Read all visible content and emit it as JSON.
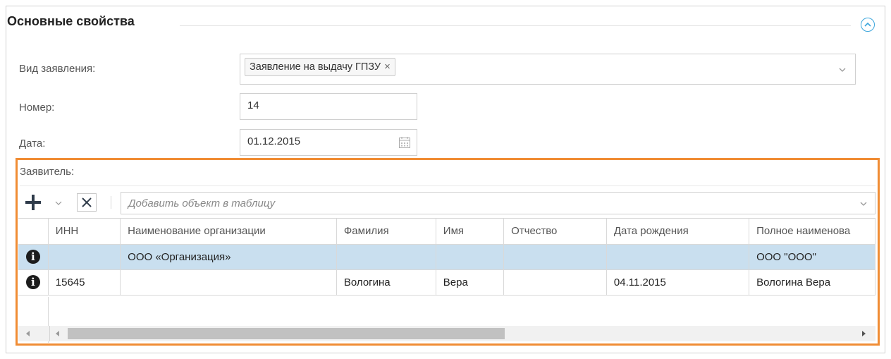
{
  "section": {
    "title": "Основные свойства",
    "collapse_icon": "chevron-up-circle-icon",
    "accent": "#3ca6dc"
  },
  "form": {
    "kind": {
      "label": "Вид заявления:",
      "tag": "Заявление на выдачу ГПЗУ",
      "tag_remove": "×"
    },
    "number": {
      "label": "Номер:",
      "value": "14"
    },
    "date": {
      "label": "Дата:",
      "value": "01.12.2015"
    }
  },
  "applicant": {
    "label": "Заявитель:",
    "highlight_color": "#f08c34",
    "toolbar": {
      "add_icon": "plus-icon",
      "delete_icon": "close-icon",
      "placeholder": "Добавить объект в таблицу"
    },
    "columns": [
      "ИНН",
      "Наименование организации",
      "Фамилия",
      "Имя",
      "Отчество",
      "Дата рождения",
      "Полное наименова"
    ],
    "rows": [
      {
        "selected": true,
        "cells": [
          "",
          "ООО «Организация»",
          "",
          "",
          "",
          "",
          "ООО \"ООО\""
        ]
      },
      {
        "selected": false,
        "cells": [
          "15645",
          "",
          "Вологина",
          "Вера",
          "",
          "04.11.2015",
          "Вологина Вера"
        ]
      }
    ],
    "row_icon": "info-icon",
    "selected_row_color": "#c9dfef"
  }
}
